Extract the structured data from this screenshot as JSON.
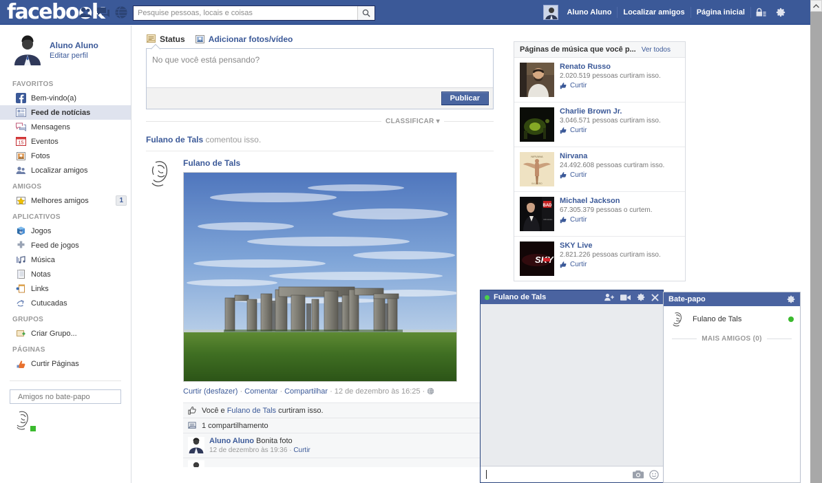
{
  "topbar": {
    "logo": "facebook",
    "icons": [
      "friend-requests-icon",
      "messages-icon",
      "notifications-globe-icon"
    ],
    "search": {
      "placeholder": "Pesquise pessoas, locais e coisas",
      "value": ""
    },
    "user_name": "Aluno Aluno",
    "find_friends": "Localizar amigos",
    "home": "Página inicial",
    "privacy_icon": "privacy-lock-icon",
    "settings_icon": "gear-icon"
  },
  "sidebar": {
    "profile": {
      "name": "Aluno Aluno",
      "edit": "Editar perfil"
    },
    "sections": [
      {
        "title": "FAVORITOS",
        "items": [
          {
            "label": "Bem-vindo(a)",
            "icon": "facebook-f-icon",
            "active": false
          },
          {
            "label": "Feed de notícias",
            "icon": "news-feed-icon",
            "active": true
          },
          {
            "label": "Mensagens",
            "icon": "messages-icon",
            "active": false
          },
          {
            "label": "Eventos",
            "icon": "calendar-15-icon",
            "active": false
          },
          {
            "label": "Fotos",
            "icon": "photos-icon",
            "active": false
          },
          {
            "label": "Localizar amigos",
            "icon": "find-friends-icon",
            "active": false
          }
        ]
      },
      {
        "title": "AMIGOS",
        "items": [
          {
            "label": "Melhores amigos",
            "icon": "star-list-icon",
            "badge": "1",
            "active": false
          }
        ]
      },
      {
        "title": "APLICATIVOS",
        "items": [
          {
            "label": "Jogos",
            "icon": "games-icon",
            "active": false
          },
          {
            "label": "Feed de jogos",
            "icon": "game-feed-icon",
            "active": false
          },
          {
            "label": "Música",
            "icon": "music-icon",
            "active": false
          },
          {
            "label": "Notas",
            "icon": "notes-icon",
            "active": false
          },
          {
            "label": "Links",
            "icon": "links-icon",
            "active": false
          },
          {
            "label": "Cutucadas",
            "icon": "poke-icon",
            "active": false
          }
        ]
      },
      {
        "title": "GRUPOS",
        "items": [
          {
            "label": "Criar Grupo...",
            "icon": "create-group-icon",
            "active": false
          }
        ]
      },
      {
        "title": "PÁGINAS",
        "items": [
          {
            "label": "Curtir Páginas",
            "icon": "like-pages-icon",
            "active": false
          }
        ]
      }
    ],
    "chat_search_placeholder": "Amigos no bate-papo"
  },
  "composer": {
    "tab_status": "Status",
    "tab_photo": "Adicionar fotos/vídeo",
    "placeholder": "No que você está pensando?",
    "value": "",
    "publish_label": "Publicar"
  },
  "feed": {
    "sort_label": "CLASSIFICAR",
    "story_actor": "Fulano de Tals",
    "story_action": "comentou isso.",
    "post": {
      "author": "Fulano de Tals",
      "photo_alt": "Stonehenge sob céu azul",
      "actions": {
        "like": "Curtir (desfazer)",
        "comment": "Comentar",
        "share": "Compartilhar",
        "time": "12 de dezembro às 16:25",
        "privacy_icon": "globe-icon"
      },
      "likes_text_prefix": "Você e ",
      "likes_text_link": "Fulano de Tals",
      "likes_text_suffix": " curtiram isso.",
      "shares_text": "1 compartilhamento",
      "comments": [
        {
          "author": "Aluno Aluno",
          "text": "Bonita foto",
          "time": "12 de dezembro às 19:36",
          "like": "Curtir"
        }
      ]
    }
  },
  "rightcol": {
    "title": "Páginas de música que você p...",
    "see_all": "Ver todos",
    "like_label": "Curtir",
    "pages": [
      {
        "name": "Renato Russo",
        "count": "2.020.519 pessoas curtiram isso.",
        "thumb": "renato-russo-photo"
      },
      {
        "name": "Charlie Brown Jr.",
        "count": "3.046.571 pessoas curtiram isso.",
        "thumb": "charlie-brown-jr-photo"
      },
      {
        "name": "Nirvana",
        "count": "24.492.608 pessoas curtiram isso.",
        "thumb": "nirvana-in-utero-cover"
      },
      {
        "name": "Michael Jackson",
        "count": "67.305.379 pessoas o curtem.",
        "thumb": "michael-jackson-bad-cover"
      },
      {
        "name": "SKY Live",
        "count": "2.821.226 pessoas curtiram isso.",
        "thumb": "sky-live-logo"
      }
    ]
  },
  "chat_window": {
    "title": "Fulano de Tals",
    "status": "online",
    "icons": [
      "add-friend-icon",
      "video-call-icon",
      "gear-icon",
      "close-icon"
    ],
    "input_value": "",
    "footer_icons": [
      "camera-icon",
      "emoji-icon"
    ]
  },
  "chat_sidebar": {
    "title": "Bate-papo",
    "gear_icon": "gear-icon",
    "friends": [
      {
        "name": "Fulano de Tals",
        "status": "online"
      }
    ],
    "more_label": "MAIS AMIGOS (0)"
  },
  "colors": {
    "fb_blue": "#3b5998",
    "chat_header": "#4a63a0",
    "link": "#3b5998",
    "online_green": "#3bba2e",
    "button_blue": "#4965a0"
  }
}
